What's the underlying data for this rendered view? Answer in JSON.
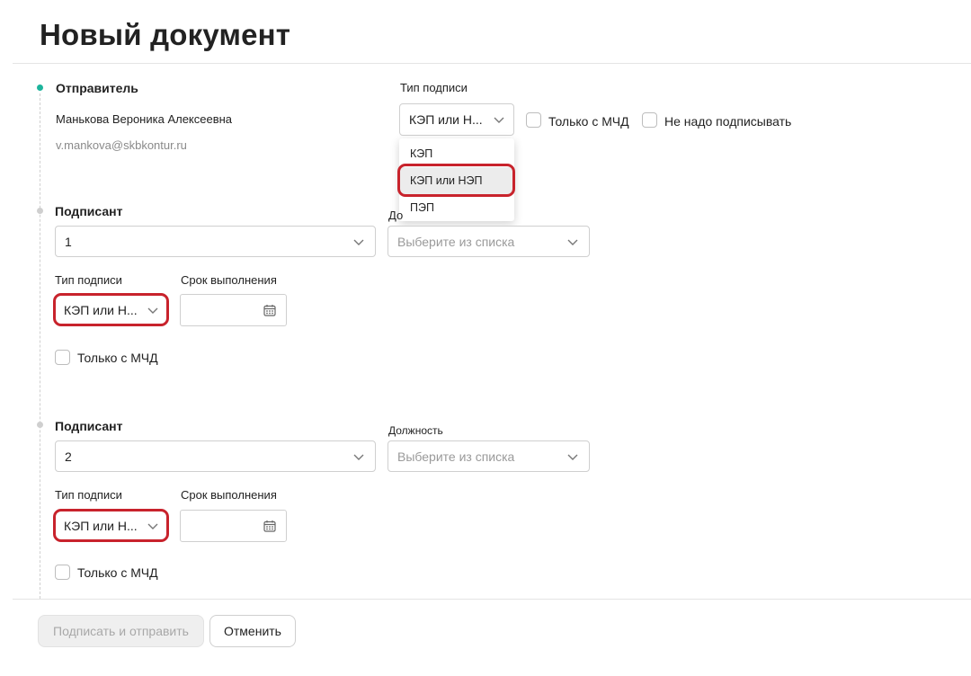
{
  "page": {
    "title": "Новый документ"
  },
  "colors": {
    "accent": "#1db49c",
    "highlight_ring": "#c8232c"
  },
  "sender": {
    "label": "Отправитель",
    "name": "Манькова Вероника Алексеевна",
    "email": "v.mankova@skbkontur.ru",
    "signature_type_label": "Тип подписи",
    "signature_type_value": "КЭП или Н...",
    "only_mchd_label": "Только с МЧД",
    "no_sign_label": "Не надо подписывать",
    "dropdown_options": [
      "КЭП",
      "КЭП или НЭП",
      "ПЭП"
    ],
    "dropdown_selected": "КЭП или НЭП"
  },
  "signers": [
    {
      "label": "Подписант",
      "value": "1",
      "position_label": "До",
      "position_placeholder": "Выберите из списка",
      "signature_type_label": "Тип подписи",
      "signature_type_value": "КЭП или Н...",
      "deadline_label": "Срок выполнения",
      "only_mchd_label": "Только с МЧД"
    },
    {
      "label": "Подписант",
      "value": "2",
      "position_label": "Должность",
      "position_placeholder": "Выберите из списка",
      "signature_type_label": "Тип подписи",
      "signature_type_value": "КЭП или Н...",
      "deadline_label": "Срок выполнения",
      "only_mchd_label": "Только с МЧД"
    }
  ],
  "footer": {
    "primary_label": "Подписать и отправить",
    "cancel_label": "Отменить"
  }
}
